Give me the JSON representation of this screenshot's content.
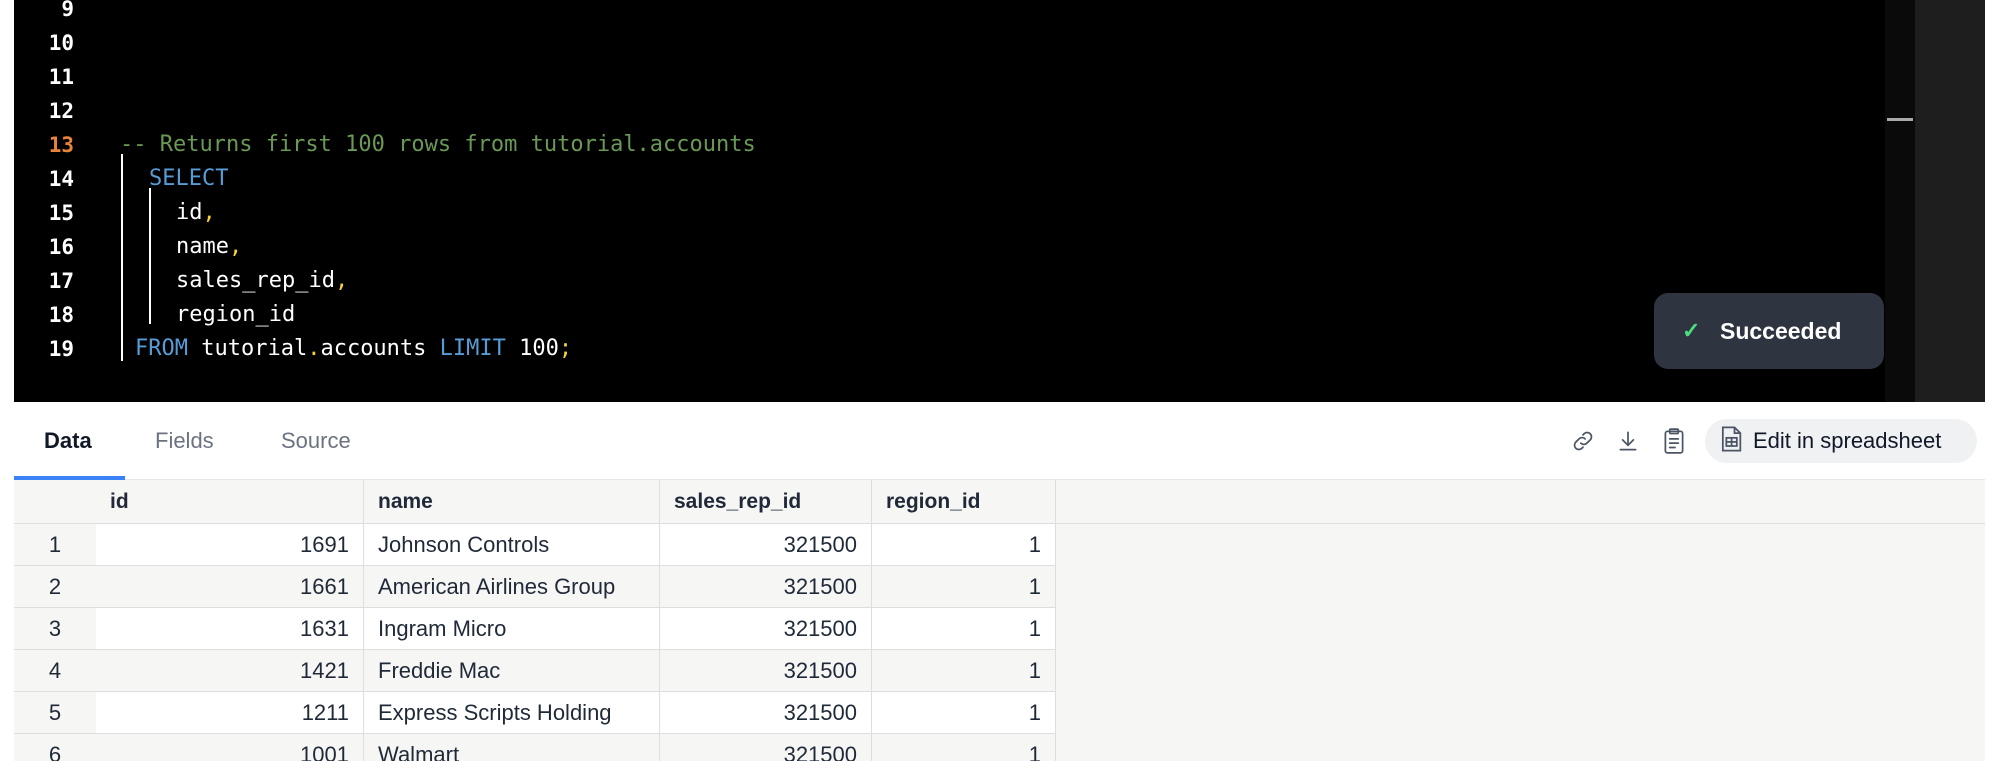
{
  "editor": {
    "lines": [
      {
        "num": "9",
        "tokens": []
      },
      {
        "num": "10",
        "tokens": []
      },
      {
        "num": "11",
        "tokens": []
      },
      {
        "num": "12",
        "tokens": []
      },
      {
        "num": "13",
        "tokens": [
          {
            "t": "-- Returns first 100 rows from tutorial.accounts",
            "k": "comment"
          }
        ]
      },
      {
        "num": "14",
        "tokens": [
          {
            "t": "SELECT",
            "k": "kw"
          }
        ]
      },
      {
        "num": "15",
        "tokens": [
          {
            "t": "id",
            "k": "plain"
          },
          {
            "t": ",",
            "k": "punc"
          }
        ]
      },
      {
        "num": "16",
        "tokens": [
          {
            "t": "name",
            "k": "plain"
          },
          {
            "t": ",",
            "k": "punc"
          }
        ]
      },
      {
        "num": "17",
        "tokens": [
          {
            "t": "sales_rep_id",
            "k": "plain"
          },
          {
            "t": ",",
            "k": "punc"
          }
        ]
      },
      {
        "num": "18",
        "tokens": [
          {
            "t": "region_id",
            "k": "plain"
          }
        ]
      },
      {
        "num": "19",
        "tokens": [
          {
            "t": "FROM",
            "k": "kw"
          },
          {
            "t": " tutorial",
            "k": "plain"
          },
          {
            "t": ".",
            "k": "punc"
          },
          {
            "t": "accounts ",
            "k": "plain"
          },
          {
            "t": "LIMIT",
            "k": "kw"
          },
          {
            "t": " 100",
            "k": "plain"
          },
          {
            "t": ";",
            "k": "punc"
          }
        ]
      }
    ],
    "active_line": "13"
  },
  "toast": {
    "icon": "check-icon",
    "label": "Succeeded"
  },
  "tabs": [
    {
      "label": "Data",
      "active": true
    },
    {
      "label": "Fields",
      "active": false
    },
    {
      "label": "Source",
      "active": false
    }
  ],
  "toolbar": {
    "icons": [
      "link-icon",
      "download-icon",
      "clipboard-icon"
    ],
    "edit_label": "Edit in spreadsheet"
  },
  "table": {
    "columns": [
      "id",
      "name",
      "sales_rep_id",
      "region_id"
    ],
    "rows": [
      {
        "n": "1",
        "id": "1691",
        "name": "Johnson Controls",
        "sales_rep_id": "321500",
        "region_id": "1"
      },
      {
        "n": "2",
        "id": "1661",
        "name": "American Airlines Group",
        "sales_rep_id": "321500",
        "region_id": "1"
      },
      {
        "n": "3",
        "id": "1631",
        "name": "Ingram Micro",
        "sales_rep_id": "321500",
        "region_id": "1"
      },
      {
        "n": "4",
        "id": "1421",
        "name": "Freddie Mac",
        "sales_rep_id": "321500",
        "region_id": "1"
      },
      {
        "n": "5",
        "id": "1211",
        "name": "Express Scripts Holding",
        "sales_rep_id": "321500",
        "region_id": "1"
      },
      {
        "n": "6",
        "id": "1001",
        "name": "Walmart",
        "sales_rep_id": "321500",
        "region_id": "1"
      }
    ]
  },
  "colors": {
    "editor_bg": "#000000",
    "comment": "#6a9955",
    "keyword": "#569cd6",
    "punctuation": "#f2d33b",
    "active_line_number": "#e8833a",
    "tab_accent": "#3b82f6",
    "toast_bg": "#2f3441",
    "success": "#4ade80"
  }
}
